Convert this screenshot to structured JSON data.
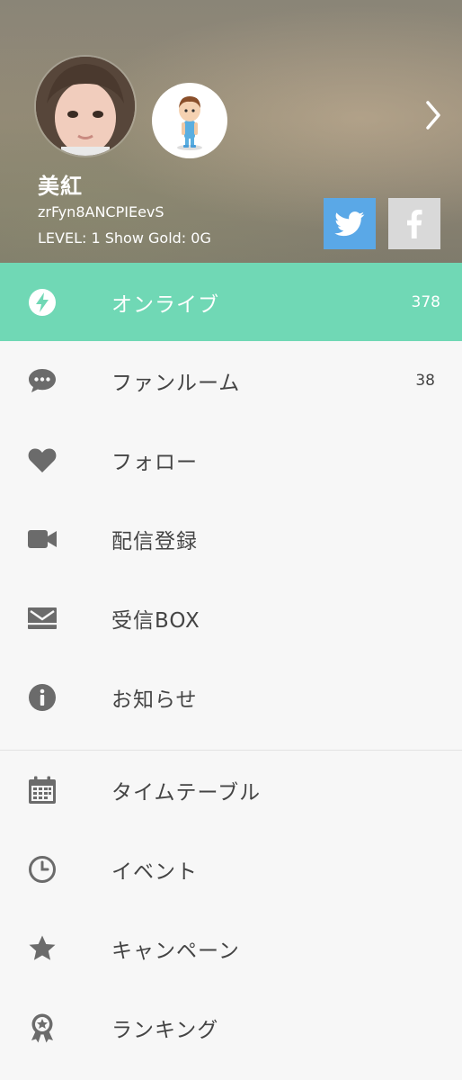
{
  "profile": {
    "name": "美紅",
    "user_id": "zrFyn8ANCPIEevS",
    "level_text": "LEVEL: 1",
    "gold_text": "Show Gold: 0G"
  },
  "social": {
    "twitter": "twitter-icon",
    "facebook": "facebook-icon"
  },
  "menu_primary": [
    {
      "label": "オンライブ",
      "count": "378",
      "icon": "bolt-icon",
      "active": true
    },
    {
      "label": "ファンルーム",
      "count": "38",
      "icon": "chat-bubble-icon"
    },
    {
      "label": "フォロー",
      "icon": "heart-icon"
    },
    {
      "label": "配信登録",
      "icon": "video-camera-icon"
    },
    {
      "label": "受信BOX",
      "icon": "inbox-mail-icon"
    },
    {
      "label": "お知らせ",
      "icon": "info-icon"
    }
  ],
  "menu_secondary": [
    {
      "label": "タイムテーブル",
      "icon": "calendar-icon"
    },
    {
      "label": "イベント",
      "icon": "clock-icon"
    },
    {
      "label": "キャンペーン",
      "icon": "star-icon"
    },
    {
      "label": "ランキング",
      "icon": "award-ribbon-icon"
    }
  ],
  "colors": {
    "active_bg": "#70d8b5",
    "twitter": "#5aa8e7",
    "facebook_bg": "#d9d9d9",
    "icon_gray": "#6b6b6b"
  }
}
